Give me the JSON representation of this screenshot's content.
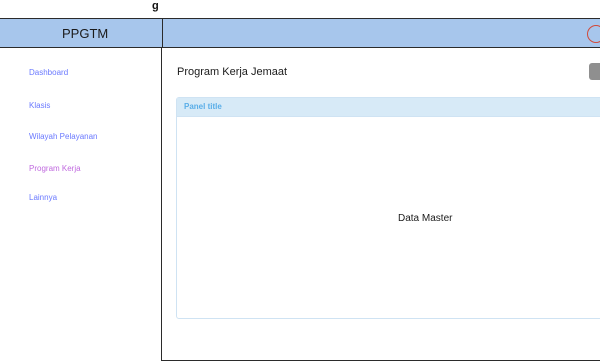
{
  "top_strip": {
    "text": "g"
  },
  "header": {
    "brand": "PPGTM"
  },
  "sidebar": {
    "items": [
      {
        "label": "Dashboard",
        "active": false
      },
      {
        "label": "Klasis",
        "active": false
      },
      {
        "label": "Wilayah Pelayanan",
        "active": false
      },
      {
        "label": "Program Kerja",
        "active": true
      },
      {
        "label": "Lainnya",
        "active": false
      }
    ]
  },
  "main": {
    "title": "Program Kerja Jemaat",
    "panel": {
      "title": "Panel title",
      "body_text": "Data Master"
    }
  },
  "colors": {
    "header_bg": "#a7c6ec",
    "sidebar_link": "#6a79ff",
    "sidebar_active": "#c06adf",
    "panel_header_bg": "#d7eaf7",
    "panel_title": "#5aaee8",
    "action_button": "#8f8f8f",
    "icon_accent": "#d14a3a"
  },
  "icons": {
    "header_right": "user-circle-icon"
  }
}
